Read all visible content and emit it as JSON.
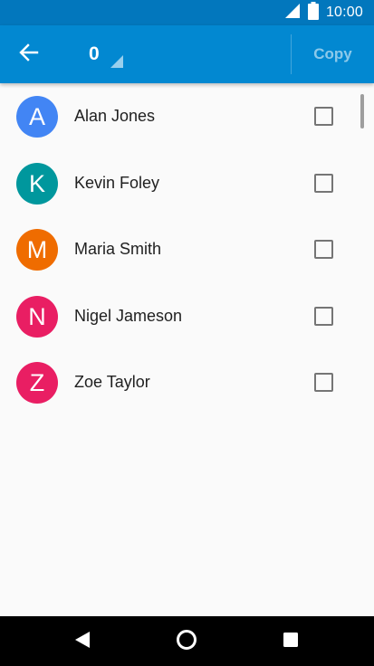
{
  "status_bar": {
    "time": "10:00",
    "icons": [
      "signal-icon",
      "battery-icon"
    ]
  },
  "app_bar": {
    "back_icon": "arrow-left-icon",
    "selected_count": "0",
    "copy_label": "Copy"
  },
  "contacts": [
    {
      "initial": "A",
      "name": "Alan Jones",
      "color": "#4285f4",
      "checked": false
    },
    {
      "initial": "K",
      "name": "Kevin Foley",
      "color": "#00979d",
      "checked": false
    },
    {
      "initial": "M",
      "name": "Maria Smith",
      "color": "#ef6c00",
      "checked": false
    },
    {
      "initial": "N",
      "name": "Nigel Jameson",
      "color": "#e91e63",
      "checked": false
    },
    {
      "initial": "Z",
      "name": "Zoe Taylor",
      "color": "#e91e63",
      "checked": false
    }
  ],
  "nav_bar": {
    "icons": [
      "back-triangle-icon",
      "home-circle-icon",
      "recents-square-icon"
    ]
  },
  "colors": {
    "status_bar": "#0277bd",
    "app_bar": "#0288d1",
    "background": "#fafafa"
  }
}
